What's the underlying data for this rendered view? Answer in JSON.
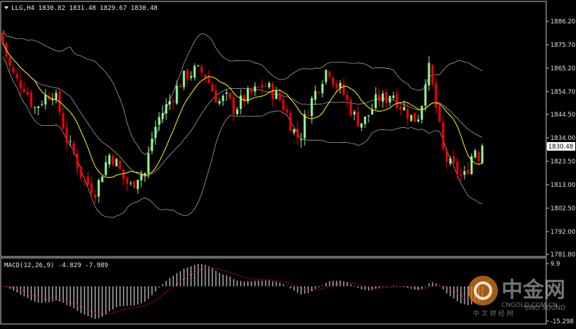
{
  "chart_data": [
    {
      "type": "candlestick",
      "title": "LLG,H4 1830.82 1831.48 1829.67 1830.48",
      "current_price": "1830.48",
      "y_ticks": [
        "1886.20",
        "1875.70",
        "1865.20",
        "1854.70",
        "1844.50",
        "1834.00",
        "1823.50",
        "1813.00",
        "1802.50",
        "1792.00",
        "1781.80"
      ],
      "ylim": [
        1781.8,
        1890
      ],
      "overlays": [
        "Moving Average (yellow)",
        "Bollinger Bands (grey)"
      ],
      "colors": {
        "bull": "#98fb98",
        "bear": "#ff0000",
        "ma": "#ffff00",
        "bands": "#a0a0a0",
        "grid": "#ffffff"
      }
    },
    {
      "type": "histogram",
      "title": "MACD(12,26,9) -4.829 -7.989",
      "y_ticks": [
        "9.9",
        "-15.298"
      ],
      "ylim": [
        -15.298,
        9.9
      ],
      "colors": {
        "histogram": "#ffffff",
        "signal": "#ff0000"
      }
    }
  ],
  "watermark": {
    "brand": "中金网",
    "url": "CNGOLD.COM.CN",
    "slogan": "中 文 财 经 网",
    "badge": "SINO SOUND"
  }
}
